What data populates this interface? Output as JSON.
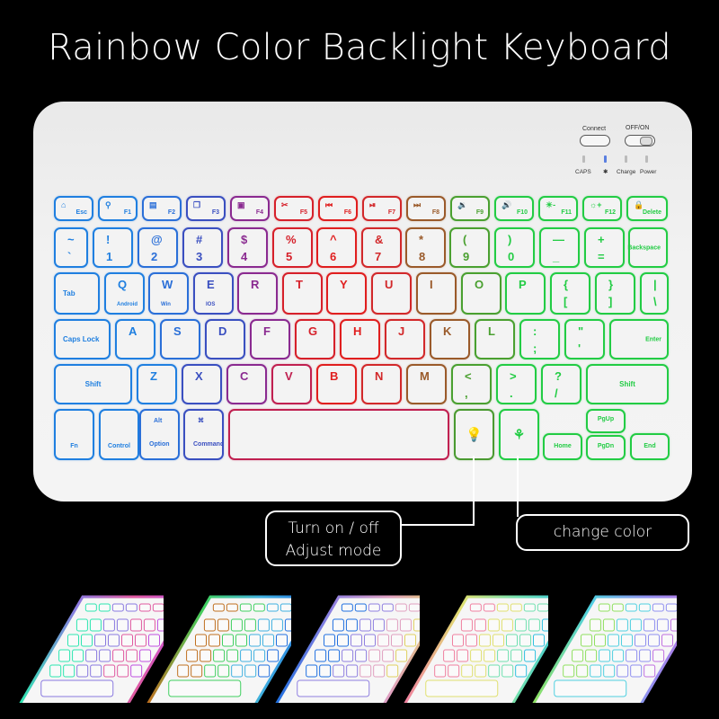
{
  "title": "Rainbow Color Backlight Keyboard",
  "controls": {
    "connect_label": "Connect",
    "power_switch_label": "OFF/ON",
    "indicators": [
      "CAPS",
      "✱",
      "Charge",
      "Power"
    ]
  },
  "rows": [
    [
      {
        "main": "Esc",
        "icon": "home-icon",
        "color": "#1f7fe0"
      },
      {
        "main": "F1",
        "icon": "search-icon",
        "color": "#1f7fe0"
      },
      {
        "main": "F2",
        "icon": "document-icon",
        "color": "#2a6fd8"
      },
      {
        "main": "F3",
        "icon": "copy-icon",
        "color": "#3a4fc0"
      },
      {
        "main": "F4",
        "icon": "paste-icon",
        "color": "#8a2a90"
      },
      {
        "main": "F5",
        "icon": "cut-icon",
        "color": "#d6202a"
      },
      {
        "main": "F6",
        "icon": "previous-track-icon",
        "color": "#e01e1e"
      },
      {
        "main": "F7",
        "icon": "play-pause-icon",
        "color": "#d2282a"
      },
      {
        "main": "F8",
        "icon": "next-track-icon",
        "color": "#9a5a2a"
      },
      {
        "main": "F9",
        "icon": "volume-down-icon",
        "color": "#4aa030"
      },
      {
        "main": "F10",
        "icon": "volume-up-icon",
        "color": "#22cc44"
      },
      {
        "main": "F11",
        "icon": "brightness-down-icon",
        "color": "#22cc44"
      },
      {
        "main": "F12",
        "icon": "brightness-up-icon",
        "color": "#22cc44"
      },
      {
        "main": "Delete",
        "icon": "lock-icon",
        "color": "#22cc44"
      }
    ],
    [
      {
        "top": "~",
        "bottom": "`",
        "color": "#1f7fe0"
      },
      {
        "top": "!",
        "bottom": "1",
        "color": "#1f7fe0"
      },
      {
        "top": "@",
        "bottom": "2",
        "color": "#2a6fd8"
      },
      {
        "top": "#",
        "bottom": "3",
        "color": "#3a4fc0"
      },
      {
        "top": "$",
        "bottom": "4",
        "color": "#8a2a90"
      },
      {
        "top": "%",
        "bottom": "5",
        "color": "#d6202a"
      },
      {
        "top": "^",
        "bottom": "6",
        "color": "#e01e1e"
      },
      {
        "top": "&",
        "bottom": "7",
        "color": "#d2282a"
      },
      {
        "top": "*",
        "bottom": "8",
        "color": "#9a5a2a"
      },
      {
        "top": "(",
        "bottom": "9",
        "color": "#4aa030"
      },
      {
        "top": ")",
        "bottom": "0",
        "color": "#22cc44"
      },
      {
        "top": "—",
        "bottom": "_",
        "color": "#22cc44"
      },
      {
        "top": "+",
        "bottom": "=",
        "color": "#22cc44"
      },
      {
        "main": "Backspace",
        "color": "#22cc44"
      }
    ],
    [
      {
        "main": "Tab",
        "color": "#1f7fe0"
      },
      {
        "top": "Q",
        "sub": "Android",
        "color": "#1f7fe0"
      },
      {
        "top": "W",
        "sub": "Win",
        "color": "#2a6fd8"
      },
      {
        "top": "E",
        "sub": "IOS",
        "color": "#3a4fc0"
      },
      {
        "top": "R",
        "color": "#8a2a90"
      },
      {
        "top": "T",
        "color": "#d6202a"
      },
      {
        "top": "Y",
        "color": "#e01e1e"
      },
      {
        "top": "U",
        "color": "#d2282a"
      },
      {
        "top": "I",
        "color": "#9a5a2a"
      },
      {
        "top": "O",
        "color": "#4aa030"
      },
      {
        "top": "P",
        "color": "#22cc44"
      },
      {
        "top": "{",
        "bottom": "[",
        "color": "#22cc44"
      },
      {
        "top": "}",
        "bottom": "]",
        "color": "#22cc44"
      },
      {
        "top": "|",
        "bottom": "\\",
        "color": "#22cc44"
      }
    ],
    [
      {
        "main": "Caps Lock",
        "color": "#1f7fe0"
      },
      {
        "top": "A",
        "color": "#1f7fe0"
      },
      {
        "top": "S",
        "color": "#2a6fd8"
      },
      {
        "top": "D",
        "color": "#3a4fc0"
      },
      {
        "top": "F",
        "color": "#8a2a90"
      },
      {
        "top": "G",
        "color": "#d6202a"
      },
      {
        "top": "H",
        "color": "#e01e1e"
      },
      {
        "top": "J",
        "color": "#d2282a"
      },
      {
        "top": "K",
        "color": "#9a5a2a"
      },
      {
        "top": "L",
        "color": "#4aa030"
      },
      {
        "top": ":",
        "bottom": ";",
        "color": "#22cc44"
      },
      {
        "top": "\"",
        "bottom": "'",
        "color": "#22cc44"
      },
      {
        "main": "Enter",
        "color": "#22cc44"
      }
    ],
    [
      {
        "main": "Shift",
        "color": "#1f7fe0"
      },
      {
        "top": "Z",
        "color": "#1f7fe0"
      },
      {
        "top": "X",
        "color": "#3a4fc0"
      },
      {
        "top": "C",
        "color": "#8a2a90"
      },
      {
        "top": "V",
        "color": "#c02050"
      },
      {
        "top": "B",
        "color": "#e01e1e"
      },
      {
        "top": "N",
        "color": "#d2282a"
      },
      {
        "top": "M",
        "color": "#9a5a2a"
      },
      {
        "top": "<",
        "bottom": ",",
        "color": "#4aa030"
      },
      {
        "top": ">",
        "bottom": ".",
        "color": "#22cc44"
      },
      {
        "top": "?",
        "bottom": "/",
        "color": "#22cc44"
      },
      {
        "main": "Shift",
        "color": "#22cc44"
      }
    ],
    [
      {
        "main": "Fn",
        "color": "#1f7fe0"
      },
      {
        "main": "Control",
        "color": "#1f7fe0"
      },
      {
        "top": "Alt",
        "main": "Option",
        "color": "#2a6fd8"
      },
      {
        "top": "⌘",
        "main": "Command",
        "color": "#3a4fc0"
      },
      {
        "main": "",
        "color": "#c02050"
      },
      {
        "main": "",
        "icon": "lightbulb-icon",
        "color": "#4a9a30"
      },
      {
        "main": "",
        "icon": "rgb-icon",
        "color": "#22cc44"
      },
      {
        "main": "Home",
        "color": "#22cc44"
      },
      {
        "main": "PgUp",
        "color": "#22cc44"
      },
      {
        "main": "PgDn",
        "color": "#22cc44"
      },
      {
        "main": "End",
        "color": "#22cc44"
      }
    ]
  ],
  "callouts": {
    "light_toggle": "Turn on / off\nAdjust mode",
    "light_toggle_line1": "Turn on / off",
    "light_toggle_line2": "Adjust mode",
    "color_change": "change color"
  },
  "variants": [
    {
      "name": "variant-1",
      "colors": [
        "#2ee6b0",
        "#8a7ae0",
        "#e05aa0",
        "#c050e0"
      ]
    },
    {
      "name": "variant-2",
      "colors": [
        "#c07020",
        "#40d060",
        "#40b0e0",
        "#2070e0"
      ]
    },
    {
      "name": "variant-3",
      "colors": [
        "#2070e0",
        "#9080e0",
        "#e0a0c0",
        "#e0d060"
      ]
    },
    {
      "name": "variant-4",
      "colors": [
        "#f080a0",
        "#e0e070",
        "#70e0b0",
        "#30c0e0"
      ]
    },
    {
      "name": "variant-5",
      "colors": [
        "#90e060",
        "#50d0e0",
        "#9090f0",
        "#c070e0"
      ]
    }
  ]
}
